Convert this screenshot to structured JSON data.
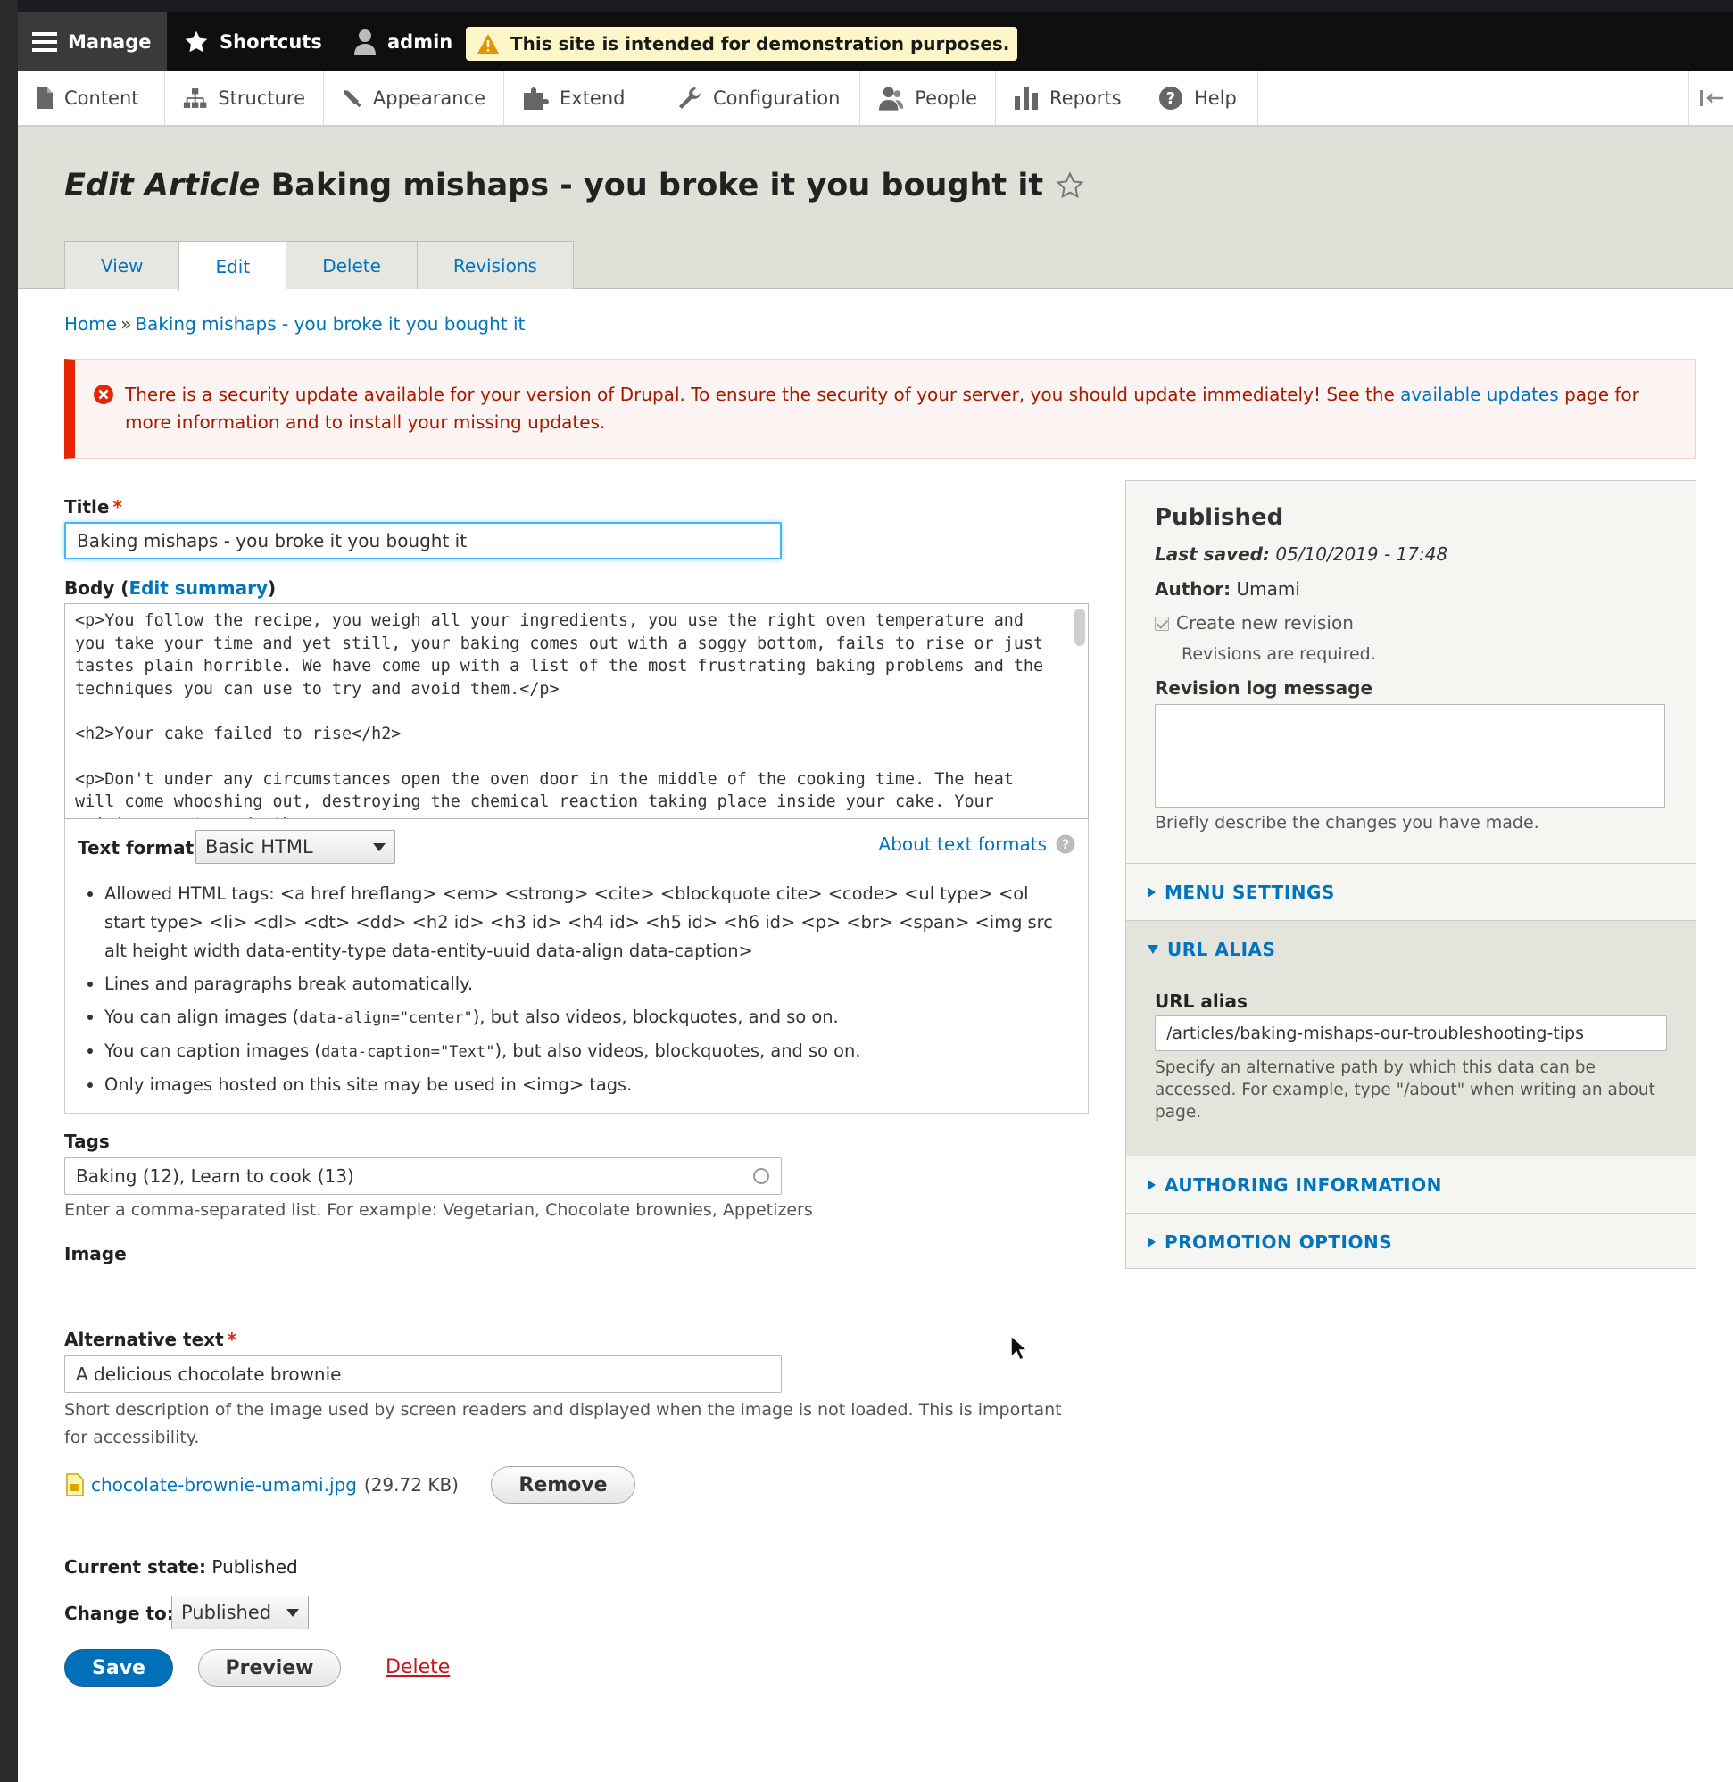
{
  "toolbar": {
    "manage": "Manage",
    "shortcuts": "Shortcuts",
    "user": "admin",
    "demo_notice": "This site is intended for demonstration purposes."
  },
  "tray": {
    "items": [
      "Content",
      "Structure",
      "Appearance",
      "Extend",
      "Configuration",
      "People",
      "Reports",
      "Help"
    ]
  },
  "page": {
    "title_prefix": "Edit Article",
    "title": "Baking mishaps - you broke it you bought it",
    "tabs": [
      "View",
      "Edit",
      "Delete",
      "Revisions"
    ],
    "active_tab": "Edit"
  },
  "breadcrumb": {
    "home": "Home",
    "separator": "»",
    "current": "Baking mishaps - you broke it you bought it"
  },
  "error": {
    "text_before": "There is a security update available for your version of Drupal. To ensure the security of your server, you should update immediately! See the",
    "link": "available updates",
    "text_after": "page for more information and to install your missing updates."
  },
  "form": {
    "title_label": "Title",
    "title_value": "Baking mishaps - you broke it you bought it",
    "body_label": "Body (",
    "body_link": "Edit summary",
    "body_label_end": ")",
    "body_lines": [
      "<p>You follow the recipe, you weigh all your ingredients, you use the right oven temperature and you take your time and yet still, your baking comes out with a soggy bottom, fails to rise or just tastes plain horrible. We have come up with a list of the most frustrating baking problems and the techniques you can use to try and avoid them.</p>",
      "<h2>Your cake failed to rise</h2>",
      "<p>Don't under any circumstances open the oven door in the middle of the cooking time. The heat will come whooshing out, destroying the chemical reaction taking place inside your cake. Your raising agent needs the"
    ],
    "text_format_label": "Text format",
    "text_format_value": "Basic HTML",
    "about_formats": "About text formats",
    "tips": [
      "Allowed HTML tags: <a href hreflang> <em> <strong> <cite> <blockquote cite> <code> <ul type> <ol start type> <li> <dl> <dt> <dd> <h2 id> <h3 id> <h4 id> <h5 id> <h6 id> <p> <br> <span> <img src alt height width data-entity-type data-entity-uuid data-align data-caption>",
      "Lines and paragraphs break automatically."
    ],
    "tip_align_pre": "You can align images (",
    "tip_align_code": "data-align=\"center\"",
    "tip_align_post": "), but also videos, blockquotes, and so on.",
    "tip_caption_pre": "You can caption images (",
    "tip_caption_code": "data-caption=\"Text\"",
    "tip_caption_post": "), but also videos, blockquotes, and so on.",
    "tip_images": "Only images hosted on this site may be used in <img> tags.",
    "tags_label": "Tags",
    "tags_value": "Baking (12), Learn to cook (13)",
    "tags_desc": "Enter a comma-separated list. For example: Vegetarian, Chocolate brownies, Appetizers",
    "image_label": "Image",
    "alt_label": "Alternative text",
    "alt_value": "A delicious chocolate brownie",
    "alt_desc": "Short description of the image used by screen readers and displayed when the image is not loaded. This is important for accessibility.",
    "file_name": "chocolate-brownie-umami.jpg",
    "file_size": "(29.72 KB)",
    "remove": "Remove",
    "current_state_label": "Current state:",
    "current_state_value": "Published",
    "change_to_label": "Change to:",
    "change_to_value": "Published",
    "save": "Save",
    "preview": "Preview",
    "delete": "Delete"
  },
  "sidebar": {
    "status": "Published",
    "last_saved_label": "Last saved:",
    "last_saved_value": "05/10/2019 - 17:48",
    "author_label": "Author:",
    "author_value": "Umami",
    "create_revision": "Create new revision",
    "revisions_required": "Revisions are required.",
    "revision_log_label": "Revision log message",
    "revision_log_desc": "Briefly describe the changes you have made.",
    "menu_settings": "MENU SETTINGS",
    "url_alias_section": "URL ALIAS",
    "url_alias_label": "URL alias",
    "url_alias_value": "/articles/baking-mishaps-our-troubleshooting-tips",
    "url_alias_desc": "Specify an alternative path by which this data can be accessed. For example, type \"/about\" when writing an about page.",
    "authoring_info": "AUTHORING INFORMATION",
    "promotion_options": "PROMOTION OPTIONS"
  },
  "colors": {
    "link": "#0074bd",
    "error_border": "#e62600",
    "primary_button": "#0071b8",
    "demo_badge": "#fdf6c9"
  }
}
